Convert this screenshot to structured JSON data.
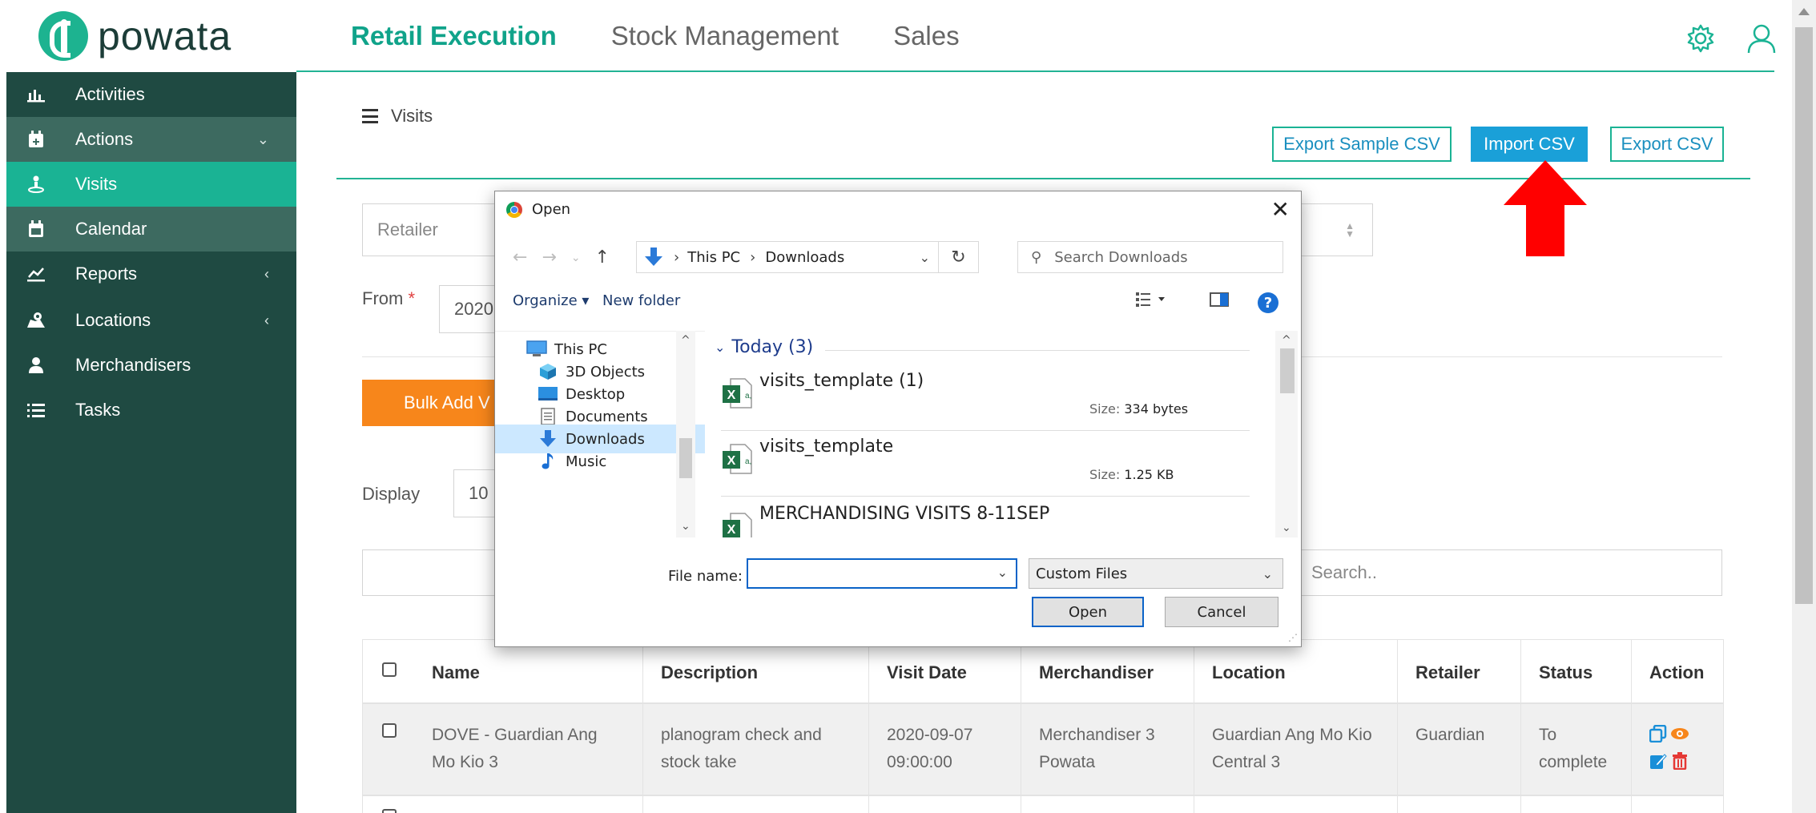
{
  "app": {
    "brand": "powata",
    "top_nav": [
      "Retail Execution",
      "Stock Management",
      "Sales"
    ],
    "colors": {
      "accent": "#1ab394",
      "sidebar": "#1f4a42",
      "orange": "#f7861b",
      "blue": "#1aa0d8",
      "arrow": "#ff0000"
    }
  },
  "sidebar": {
    "items": [
      {
        "label": "Activities",
        "icon": "bar-chart-icon"
      },
      {
        "label": "Actions",
        "icon": "calendar-plus-icon",
        "chevron": "⌄"
      },
      {
        "label": "Visits",
        "icon": "pin-person-icon"
      },
      {
        "label": "Calendar",
        "icon": "calendar-icon"
      },
      {
        "label": "Reports",
        "icon": "line-chart-icon",
        "chevron": "‹"
      },
      {
        "label": "Locations",
        "icon": "map-icon",
        "chevron": "‹"
      },
      {
        "label": "Merchandisers",
        "icon": "user-icon"
      },
      {
        "label": "Tasks",
        "icon": "list-icon"
      }
    ]
  },
  "page": {
    "breadcrumb": "Visits",
    "buttons": {
      "export_sample": "Export Sample CSV",
      "import": "Import CSV",
      "export": "Export CSV"
    },
    "filters": {
      "retailer_placeholder": "Retailer",
      "from_label": "From",
      "required_mark": "*",
      "from_value": "2020",
      "bulk_add": "Bulk Add V",
      "display_label": "Display",
      "display_value": "10",
      "search_placeholder": "Search.."
    },
    "table": {
      "headers": [
        "Name",
        "Description",
        "Visit Date",
        "Merchandiser",
        "Location",
        "Retailer",
        "Status",
        "Action"
      ],
      "rows": [
        {
          "name_line1": "DOVE - Guardian Ang",
          "name_line2": "Mo Kio 3",
          "desc_line1": "planogram check and",
          "desc_line2": "stock take",
          "date_line1": "2020-09-07",
          "date_line2": "09:00:00",
          "merch_line1": "Merchandiser 3",
          "merch_line2": "Powata",
          "loc_line1": "Guardian Ang Mo Kio",
          "loc_line2": "Central 3",
          "retailer": "Guardian",
          "status_line1": "To",
          "status_line2": "complete"
        }
      ]
    }
  },
  "dialog": {
    "title": "Open",
    "path": [
      "This PC",
      "Downloads"
    ],
    "search_placeholder": "Search Downloads",
    "organize": "Organize ▾",
    "new_folder": "New folder",
    "nav_items": [
      {
        "label": "This PC",
        "icon": "computer-icon"
      },
      {
        "label": "3D Objects",
        "icon": "cube-icon"
      },
      {
        "label": "Desktop",
        "icon": "desktop-icon"
      },
      {
        "label": "Documents",
        "icon": "document-icon"
      },
      {
        "label": "Downloads",
        "icon": "download-icon"
      },
      {
        "label": "Music",
        "icon": "music-icon"
      }
    ],
    "group": "Today (3)",
    "files": [
      {
        "name": "visits_template (1)",
        "size_label": "Size:",
        "size": "334 bytes"
      },
      {
        "name": "visits_template",
        "size_label": "Size:",
        "size": "1.25 KB"
      },
      {
        "name": "MERCHANDISING VISITS 8-11SEP",
        "size_label": "",
        "size": ""
      }
    ],
    "file_name_label": "File name:",
    "file_name_value": "",
    "file_type": "Custom Files",
    "open": "Open",
    "cancel": "Cancel"
  }
}
